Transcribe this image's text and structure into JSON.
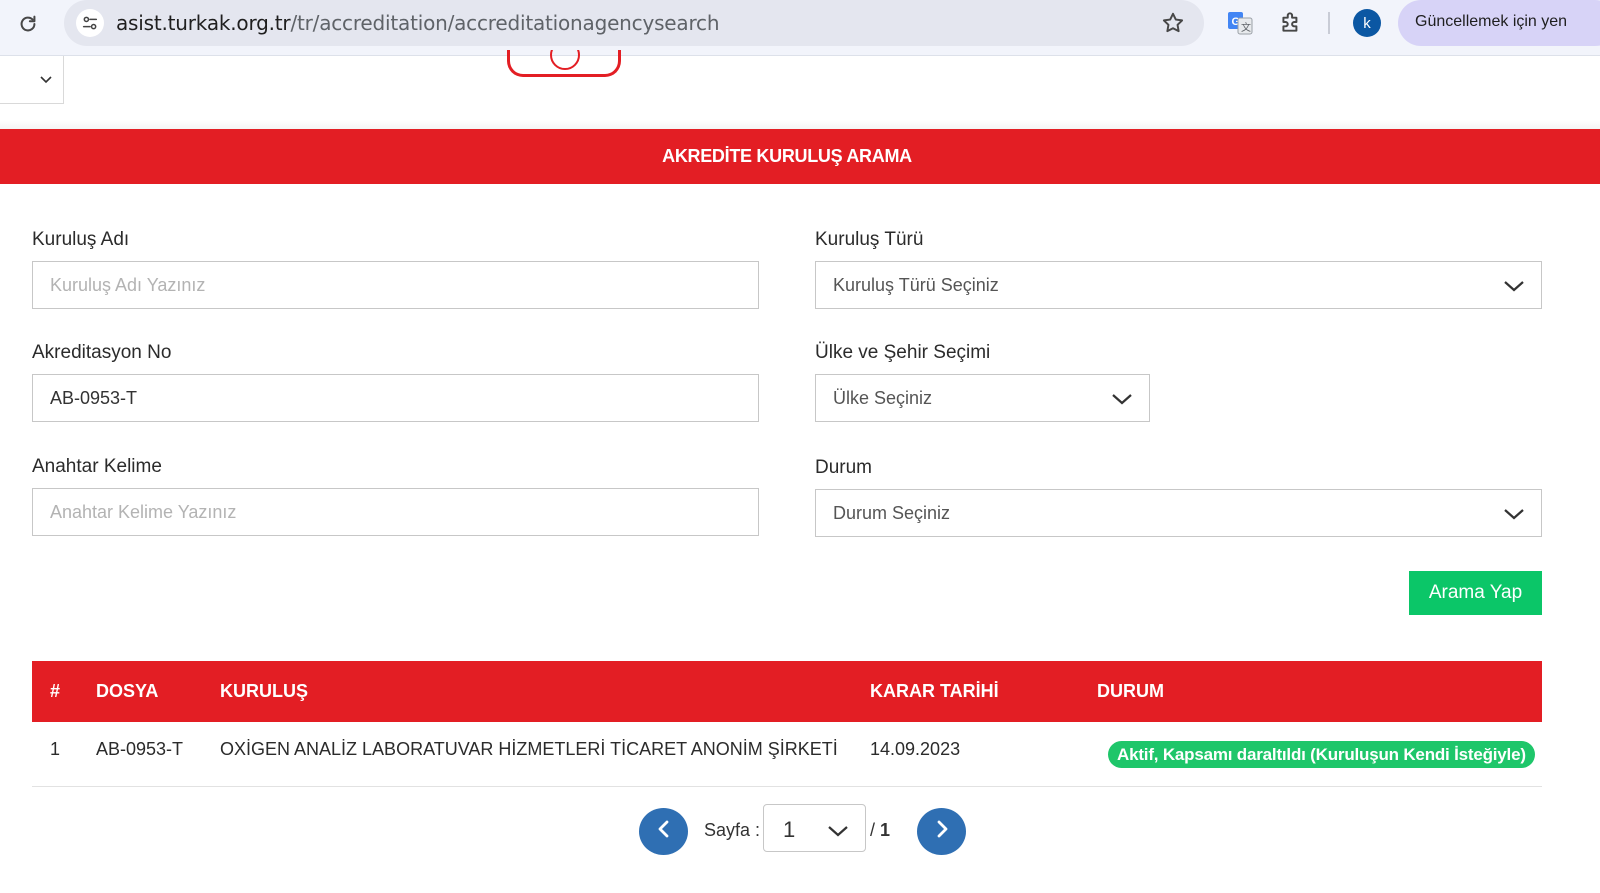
{
  "browser": {
    "url_host": "asist.turkak.org.tr",
    "url_path": "/tr/accreditation/accreditationagencysearch",
    "profile_initial": "k",
    "update_label": "Güncellemek için yen"
  },
  "page": {
    "banner_title": "AKREDİTE KURULUŞ ARAMA"
  },
  "form": {
    "org_name": {
      "label": "Kuruluş Adı",
      "placeholder": "Kuruluş Adı Yazınız"
    },
    "accreditation_no": {
      "label": "Akreditasyon No",
      "value": "AB-0953-T"
    },
    "keyword": {
      "label": "Anahtar Kelime",
      "placeholder": "Anahtar Kelime Yazınız"
    },
    "org_type": {
      "label": "Kuruluş Türü",
      "selected": "Kuruluş Türü Seçiniz"
    },
    "country_city": {
      "label": "Ülke ve Şehir Seçimi",
      "selected": "Ülke Seçiniz"
    },
    "status": {
      "label": "Durum",
      "selected": "Durum Seçiniz"
    },
    "search_button": "Arama Yap"
  },
  "table": {
    "headers": [
      "#",
      "DOSYA",
      "KURULUŞ",
      "KARAR TARİHİ",
      "DURUM"
    ],
    "rows": [
      {
        "index": "1",
        "file": "AB-0953-T",
        "organization": "OXİGEN ANALİZ LABORATUVAR HİZMETLERİ TİCARET ANONİM ŞİRKETİ",
        "decision_date": "14.09.2023",
        "status": "Aktif, Kapsamı daraltıldı (Kuruluşun Kendi İsteğiyle)"
      }
    ]
  },
  "pagination": {
    "page_label": "Sayfa :",
    "current_page": "1",
    "separator": "/",
    "total_pages": "1"
  },
  "colors": {
    "brand_red": "#e31e24",
    "success_green": "#0bc668",
    "pager_blue": "#2f6fb3"
  },
  "icons": [
    "reload-icon",
    "site-info-icon",
    "bookmark-star-icon",
    "translate-icon",
    "extensions-icon",
    "chevron-down-icon",
    "chevron-left-icon",
    "chevron-right-icon"
  ]
}
